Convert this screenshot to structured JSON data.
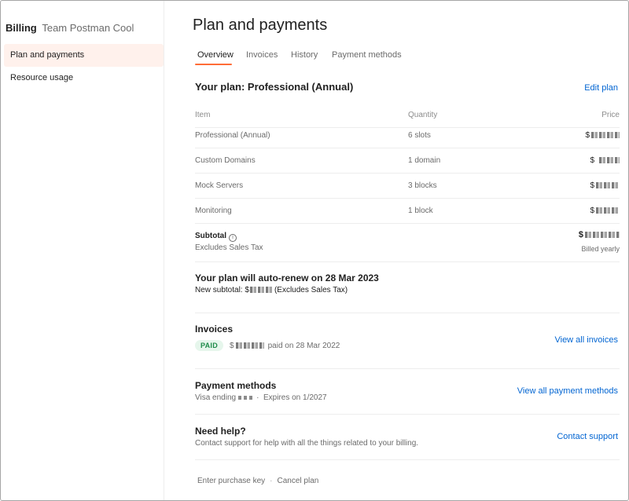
{
  "sidebar": {
    "title": "Billing",
    "team": "Team Postman Cool",
    "items": [
      {
        "label": "Plan and payments"
      },
      {
        "label": "Resource usage"
      }
    ]
  },
  "page": {
    "title": "Plan and payments",
    "tabs": [
      {
        "label": "Overview",
        "active": true
      },
      {
        "label": "Invoices"
      },
      {
        "label": "History"
      },
      {
        "label": "Payment methods"
      }
    ]
  },
  "plan": {
    "title": "Your plan: Professional (Annual)",
    "edit_label": "Edit plan",
    "headers": {
      "item": "Item",
      "quantity": "Quantity",
      "price": "Price"
    },
    "rows": [
      {
        "item": "Professional (Annual)",
        "quantity": "6 slots",
        "price": "$"
      },
      {
        "item": "Custom Domains",
        "quantity": "1 domain",
        "price": "$"
      },
      {
        "item": "Mock Servers",
        "quantity": "3 blocks",
        "price": "$"
      },
      {
        "item": "Monitoring",
        "quantity": "1 block",
        "price": "$"
      }
    ],
    "subtotal_label": "Subtotal",
    "subtotal_note": "Excludes Sales Tax",
    "subtotal_price": "$",
    "billing_cycle": "Billed yearly"
  },
  "renewal": {
    "title": "Your plan will auto-renew on 28 Mar 2023",
    "subtotal_prefix": "New subtotal: $",
    "subtotal_suffix": "(Excludes Sales Tax)"
  },
  "invoices": {
    "title": "Invoices",
    "badge": "PAID",
    "amount": "$",
    "paid_text": "paid on 28 Mar 2022",
    "link": "View all invoices"
  },
  "payment_methods": {
    "title": "Payment methods",
    "card_prefix": "Visa ending",
    "separator": "·",
    "expires": "Expires on 1/2027",
    "link": "View all payment methods"
  },
  "help": {
    "title": "Need help?",
    "text": "Contact support for help with all the things related to your billing.",
    "link": "Contact support"
  },
  "footer": {
    "purchase_key": "Enter purchase key",
    "separator": "·",
    "cancel": "Cancel plan"
  },
  "colors": {
    "accent": "#ff6c37",
    "link": "#0265d2",
    "active_bg": "#fff1ec",
    "paid_bg": "#e6f6ec",
    "paid_text": "#1e8b4a"
  }
}
